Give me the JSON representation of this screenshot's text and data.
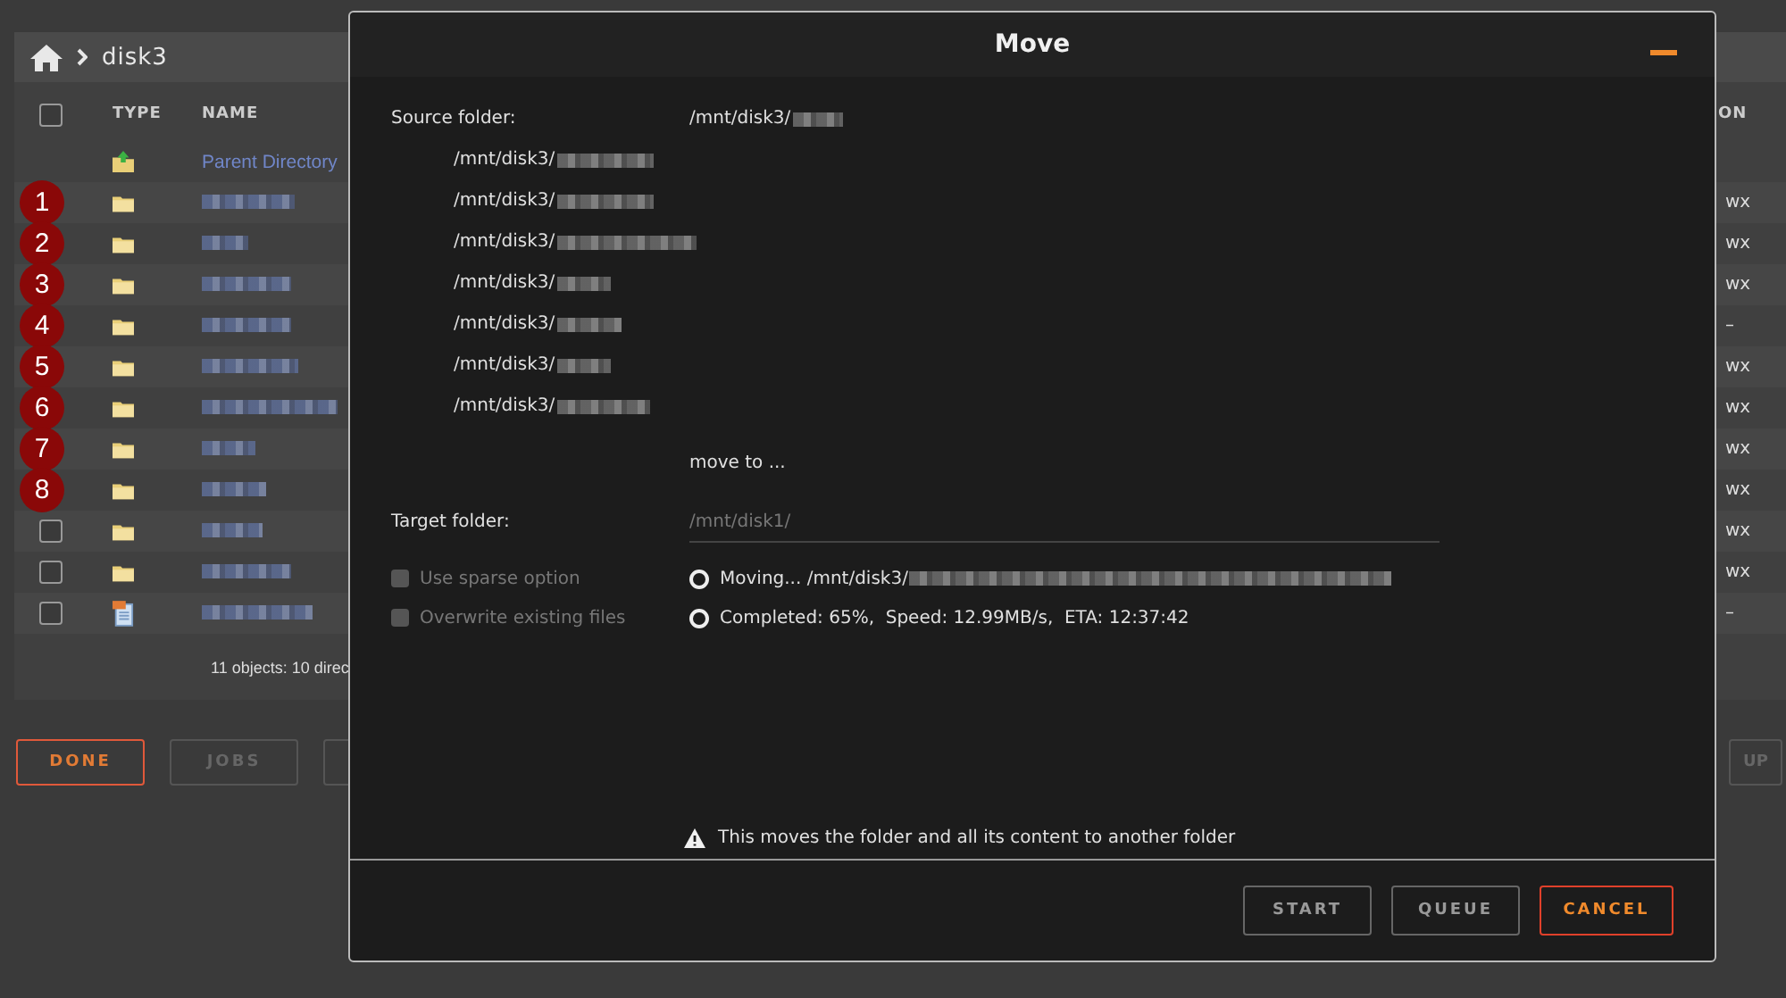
{
  "file_manager": {
    "breadcrumb": {
      "current": "disk3"
    },
    "header": {
      "select_all_checked": false,
      "columns": [
        "TYPE",
        "NAME",
        "ON"
      ]
    },
    "rows": [
      {
        "kind": "parent",
        "name": "Parent Directory"
      },
      {
        "kind": "folder",
        "marker": "1",
        "permissions": "wx"
      },
      {
        "kind": "folder",
        "marker": "2",
        "permissions": "wx"
      },
      {
        "kind": "folder",
        "marker": "3",
        "permissions": "wx"
      },
      {
        "kind": "folder",
        "marker": "4",
        "permissions": "–"
      },
      {
        "kind": "folder",
        "marker": "5",
        "permissions": "wx"
      },
      {
        "kind": "folder",
        "marker": "6",
        "permissions": "wx"
      },
      {
        "kind": "folder",
        "marker": "7",
        "permissions": "wx"
      },
      {
        "kind": "folder",
        "marker": "8",
        "permissions": "wx"
      },
      {
        "kind": "folder",
        "checked": false,
        "permissions": "wx"
      },
      {
        "kind": "folder",
        "checked": false,
        "permissions": "wx"
      },
      {
        "kind": "file",
        "checked": false,
        "permissions": "–"
      }
    ],
    "summary": "11 objects: 10 direc",
    "buttons": [
      {
        "label": "DONE",
        "primary": true
      },
      {
        "label": "JOBS",
        "primary": false
      }
    ],
    "right_button": "UP"
  },
  "dialog": {
    "title": "Move",
    "source_label": "Source folder:",
    "source_paths": [
      "/mnt/disk3/",
      "/mnt/disk3/",
      "/mnt/disk3/",
      "/mnt/disk3/",
      "/mnt/disk3/",
      "/mnt/disk3/",
      "/mnt/disk3/",
      "/mnt/disk3/"
    ],
    "move_to": "move to ...",
    "target_label": "Target folder:",
    "target": {
      "value": "/mnt/disk1/",
      "disabled": true
    },
    "options": [
      {
        "label": "Use sparse option",
        "checked": false,
        "disabled": true
      },
      {
        "label": "Overwrite existing files",
        "checked": false,
        "disabled": true
      }
    ],
    "status": [
      {
        "text": "Moving... /mnt/disk3/",
        "redacted": true
      },
      {
        "text": "Completed: 65%,  Speed: 12.99MB/s,  ETA: 12:37:42",
        "redacted": false
      }
    ],
    "warning": "This moves the folder and all its content to another folder",
    "buttons": [
      {
        "label": "START",
        "kind": "normal"
      },
      {
        "label": "QUEUE",
        "kind": "normal"
      },
      {
        "label": "CANCEL",
        "kind": "cancel"
      }
    ]
  }
}
